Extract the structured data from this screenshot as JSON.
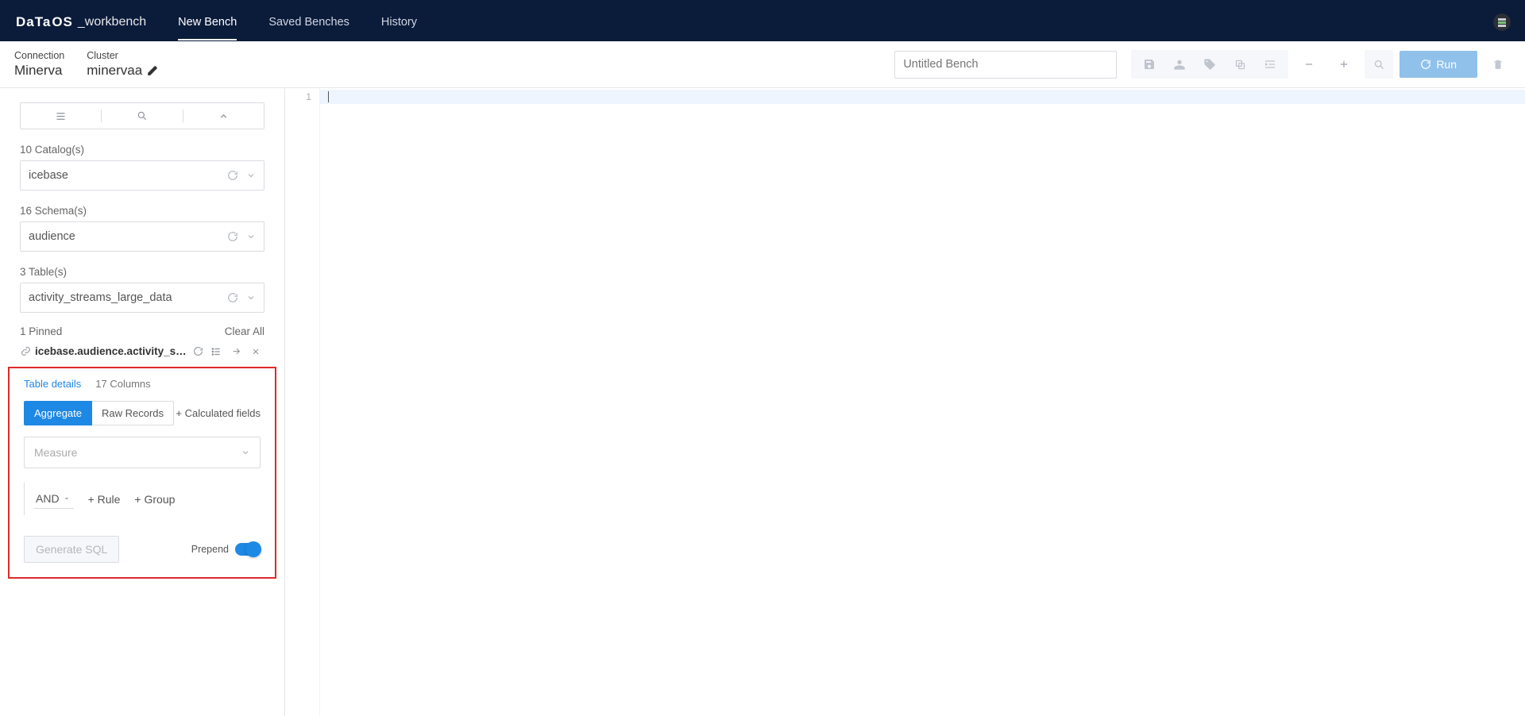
{
  "header": {
    "logo_main": "DaTa",
    "logo_os": "OS",
    "logo_sub": "_workbench",
    "nav": {
      "new_bench": "New Bench",
      "saved_benches": "Saved Benches",
      "history": "History"
    }
  },
  "conn": {
    "connection_label": "Connection",
    "connection_value": "Minerva",
    "cluster_label": "Cluster",
    "cluster_value": "minervaa"
  },
  "toolbar": {
    "bench_title_placeholder": "Untitled Bench",
    "run_label": "Run"
  },
  "sidebar": {
    "catalog_count": "10 Catalog(s)",
    "catalog_value": "icebase",
    "schema_count": "16 Schema(s)",
    "schema_value": "audience",
    "table_count": "3 Table(s)",
    "table_value": "activity_streams_large_data",
    "pinned": "1 Pinned",
    "clear_all": "Clear All",
    "table_path": "icebase.audience.activity_str..."
  },
  "panel": {
    "tab_table_details": "Table details",
    "tab_columns": "17 Columns",
    "btn_aggregate": "Aggregate",
    "btn_raw": "Raw Records",
    "calc_fields": "+ Calculated fields",
    "measure_ph": "Measure",
    "and_label": "AND",
    "add_rule": "+ Rule",
    "add_group": "+ Group",
    "generate": "Generate SQL",
    "prepend": "Prepend"
  },
  "editor": {
    "line_no": "1"
  }
}
